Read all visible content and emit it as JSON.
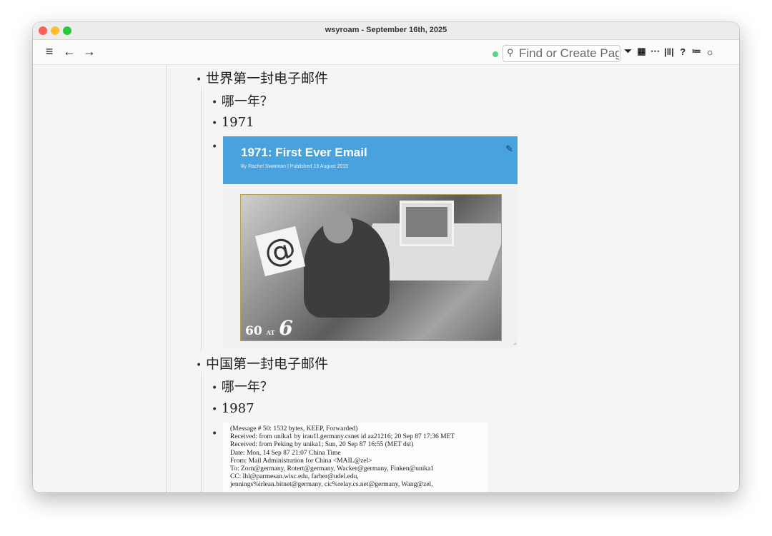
{
  "window": {
    "title": "wsyroam - September 16th, 2025"
  },
  "toolbar": {
    "menu_icon": "≡",
    "back_icon": "←",
    "forward_icon": "→",
    "search_placeholder": "Find or Create Page",
    "icons": {
      "filter": "⏷",
      "calendar": "▦",
      "more": "⋯",
      "sidebar": "|‖|",
      "help": "?",
      "outline": "≔",
      "theme": "☼"
    }
  },
  "outline": [
    {
      "text": "世界第一封电子邮件",
      "children": [
        {
          "text": "哪一年？"
        },
        {
          "text": "1971"
        }
      ]
    },
    {
      "text": "中国第一封电子邮件",
      "children": [
        {
          "text": "哪一年？"
        },
        {
          "text": "1987"
        }
      ]
    }
  ],
  "card": {
    "title": "1971: First Ever Email",
    "meta": "By Rachel Swatman  |  Published 19 August 2015",
    "photo_sign": "@",
    "photo_logo_small": "60",
    "photo_logo_at": "AT",
    "photo_logo_big": "6"
  },
  "email_doc": {
    "lines": [
      "(Message # 50: 1532 bytes, KEEP, Forwarded)",
      "Received: from unika1 by irau1l.germany.csnet id aa21216; 20 Sep 87 17:36 MET",
      "Received: from Peking by unika1; Sun, 20 Sep 87 16:55 (MET dst)",
      "Date:    Mon, 14 Sep 87 21:07 China Time",
      "From:     Mail Administration for China <MAIL@zel>",
      "To:     Zorn@germany, Rotert@germany, Wacker@germany, Finken@unika1",
      "CC:     lhl@parmesan.wisc.edu, farber@udel.edu,",
      "         jennings%irlean.bitnet@germany, cic%relay.cs.net@germany, Wang@zel,"
    ]
  }
}
